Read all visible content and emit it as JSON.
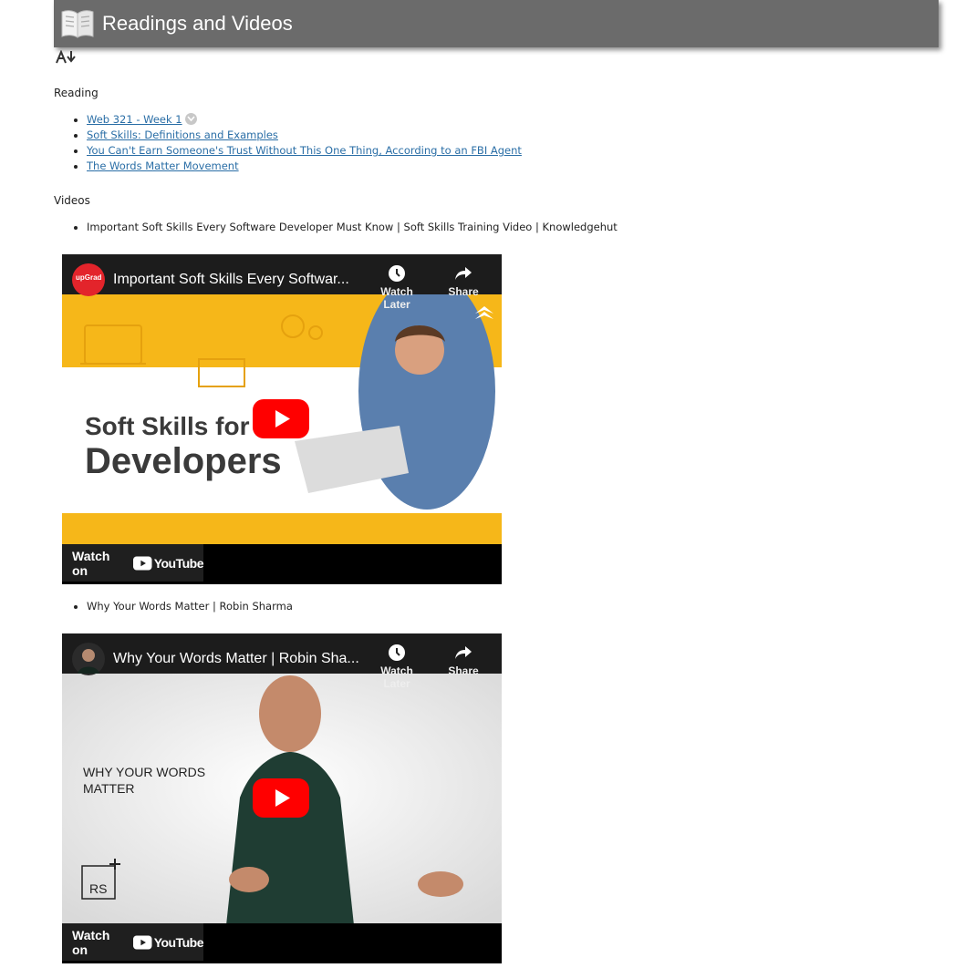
{
  "header": {
    "title": "Readings and Videos",
    "icon": "open-book-icon",
    "background": "#6b6b6b"
  },
  "toolbar": {
    "icon": "text-size-icon"
  },
  "reading": {
    "label": "Reading",
    "links": [
      {
        "text": "Web 321 - Week 1"
      },
      {
        "text": "Soft Skills: Definitions and Examples"
      },
      {
        "text": "You Can't Earn Someone's Trust Without This One Thing, According to an FBI Agent"
      },
      {
        "text": "The Words Matter Movement"
      }
    ]
  },
  "videos": {
    "label": "Videos",
    "items": [
      {
        "heading": "Important Soft Skills Every Software Developer Must Know | Soft Skills Training Video | Knowledgehut",
        "player_title": "Important Soft Skills Every Softwar...",
        "watch_later": "Watch Later",
        "share": "Share",
        "watch_on": "Watch on",
        "youtube": "YouTube",
        "channel_badge": "upGrad",
        "thumb_text_line1": "Soft Skills for",
        "thumb_text_line2": "Developers"
      },
      {
        "heading": "Why Your Words Matter | Robin Sharma",
        "player_title": "Why Your Words Matter | Robin Sha...",
        "watch_later": "Watch Later",
        "share": "Share",
        "watch_on": "Watch on",
        "youtube": "YouTube",
        "thumb_text_line1": "WHY YOUR WORDS",
        "thumb_text_line2": "MATTER",
        "logo_text": "RS"
      }
    ]
  },
  "colors": {
    "link": "#2a6ea6",
    "yellow": "#f6b719",
    "play_red": "#ff0000"
  }
}
